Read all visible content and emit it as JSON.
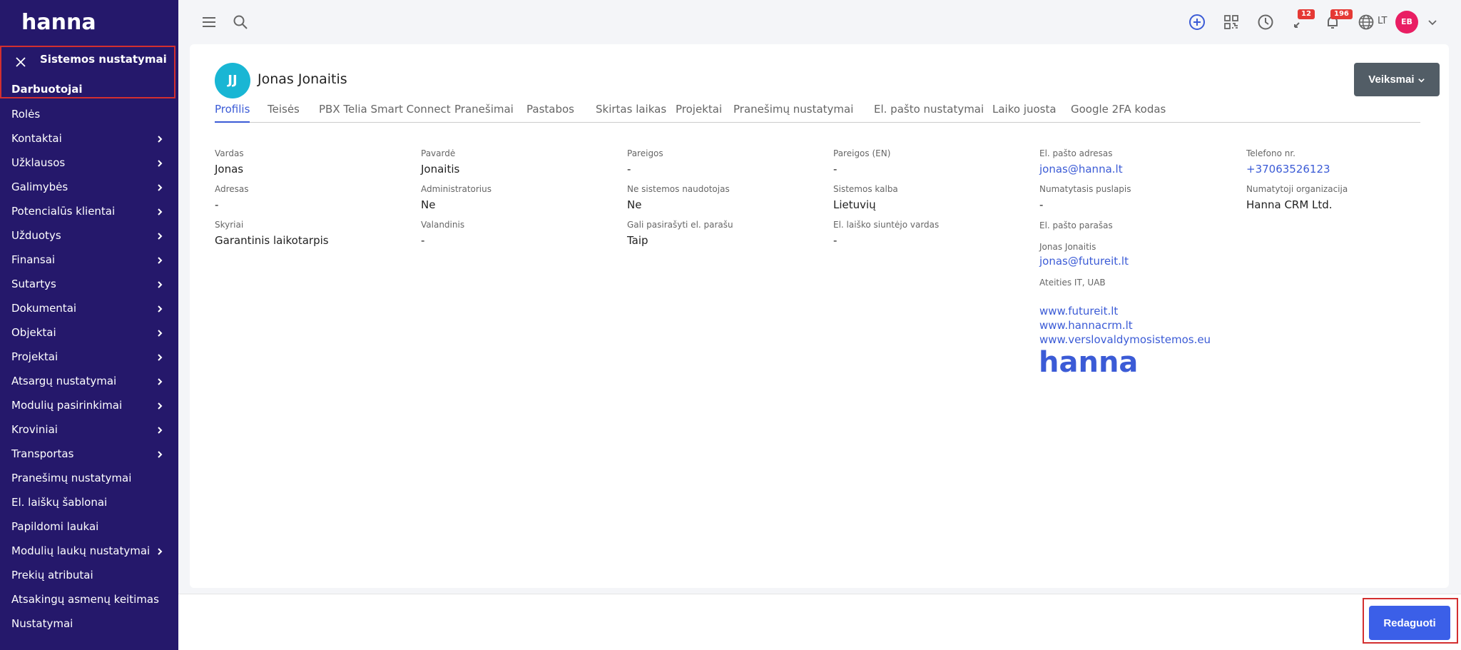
{
  "sidebar": {
    "logo": "hanna",
    "section_title": "Sistemos nustatymai",
    "active_item": "Darbuotojai",
    "items": [
      {
        "label": "Rolės",
        "has_children": false
      },
      {
        "label": "Kontaktai",
        "has_children": true
      },
      {
        "label": "Užklausos",
        "has_children": true
      },
      {
        "label": "Galimybės",
        "has_children": true
      },
      {
        "label": "Potencialūs klientai",
        "has_children": true
      },
      {
        "label": "Užduotys",
        "has_children": true
      },
      {
        "label": "Finansai",
        "has_children": true
      },
      {
        "label": "Sutartys",
        "has_children": true
      },
      {
        "label": "Dokumentai",
        "has_children": true
      },
      {
        "label": "Objektai",
        "has_children": true
      },
      {
        "label": "Projektai",
        "has_children": true
      },
      {
        "label": "Atsargų nustatymai",
        "has_children": true
      },
      {
        "label": "Modulių pasirinkimai",
        "has_children": true
      },
      {
        "label": "Kroviniai",
        "has_children": true
      },
      {
        "label": "Transportas",
        "has_children": true
      },
      {
        "label": "Pranešimų nustatymai",
        "has_children": false
      },
      {
        "label": "El. laiškų šablonai",
        "has_children": false
      },
      {
        "label": "Papildomi laukai",
        "has_children": false
      },
      {
        "label": "Modulių laukų nustatymai",
        "has_children": true
      },
      {
        "label": "Prekių atributai",
        "has_children": false
      },
      {
        "label": "Atsakingų asmenų keitimas",
        "has_children": false
      },
      {
        "label": "Nustatymai",
        "has_children": false
      }
    ]
  },
  "topbar": {
    "calls_badge": "12",
    "notifications_badge": "196",
    "language": "LT",
    "user_initials": "EB"
  },
  "profile": {
    "initials": "JJ",
    "name": "Jonas Jonaitis",
    "actions_label": "Veiksmai"
  },
  "tabs": [
    {
      "label": "Profilis",
      "active": true
    },
    {
      "label": "Teisės"
    },
    {
      "label": "PBX Telia Smart Connect"
    },
    {
      "label": "Pranešimai"
    },
    {
      "label": "Pastabos"
    },
    {
      "label": "Skirtas laikas"
    },
    {
      "label": "Projektai"
    },
    {
      "label": "Pranešimų nustatymai"
    },
    {
      "label": "El. pašto nustatymai"
    },
    {
      "label": "Laiko juosta"
    },
    {
      "label": "Google 2FA kodas"
    }
  ],
  "fields": {
    "first_name": {
      "label": "Vardas",
      "value": "Jonas"
    },
    "last_name": {
      "label": "Pavardė",
      "value": "Jonaitis"
    },
    "position": {
      "label": "Pareigos",
      "value": "-"
    },
    "position_en": {
      "label": "Pareigos (EN)",
      "value": "-"
    },
    "email": {
      "label": "El. pašto adresas",
      "value": "jonas@hanna.lt"
    },
    "phone": {
      "label": "Telefono nr.",
      "value": "+37063526123"
    },
    "address": {
      "label": "Adresas",
      "value": "-"
    },
    "administrator": {
      "label": "Administratorius",
      "value": "Ne"
    },
    "non_system_user": {
      "label": "Ne sistemos naudotojas",
      "value": "Ne"
    },
    "system_language": {
      "label": "Sistemos kalba",
      "value": "Lietuvių"
    },
    "default_page": {
      "label": "Numatytasis puslapis",
      "value": "-"
    },
    "default_org": {
      "label": "Numatytoji organizacija",
      "value": "Hanna CRM Ltd."
    },
    "departments": {
      "label": "Skyriai",
      "value": "Garantinis laikotarpis"
    },
    "hourly": {
      "label": "Valandinis",
      "value": "-"
    },
    "can_sign": {
      "label": "Gali pasirašyti el. parašu",
      "value": "Taip"
    },
    "sender_name": {
      "label": "El. laiško siuntėjo vardas",
      "value": "-"
    }
  },
  "signature": {
    "label": "El. pašto parašas",
    "name": "Jonas Jonaitis",
    "email": "jonas@futureit.lt",
    "company": "Ateities IT, UAB",
    "links": [
      "www.futureit.lt",
      "www.hannacrm.lt",
      "www.verslovaldymosistemos.eu"
    ],
    "logo": "hanna"
  },
  "footer": {
    "edit_label": "Redaguoti"
  }
}
